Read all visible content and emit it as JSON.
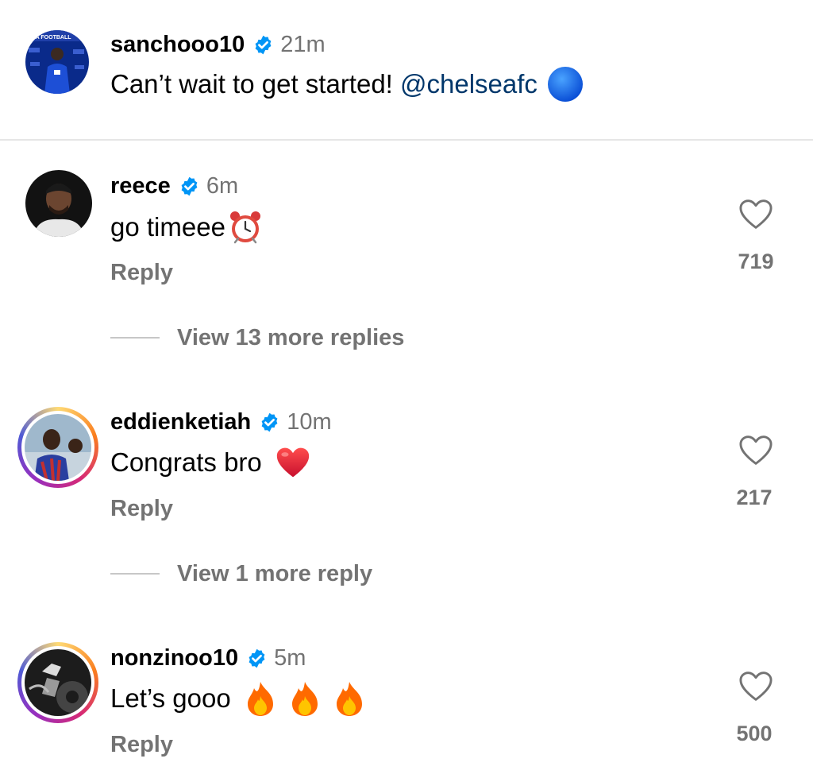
{
  "caption": {
    "username": "sanchooo10",
    "time": "21m",
    "text": "Can’t wait to get started! ",
    "mention": "@chelseafc",
    "emoji_icon": "blue-circle-icon",
    "avatar_icon": "player-avatar-icon"
  },
  "comments": [
    {
      "username": "reece",
      "time": "6m",
      "text": "go timeee",
      "emoji_icons": [
        "alarm-clock-icon"
      ],
      "reply_label": "Reply",
      "likes": "719",
      "view_replies": "View 13 more replies",
      "story_ring": false
    },
    {
      "username": "eddienketiah",
      "time": "10m",
      "text": "Congrats bro ",
      "emoji_icons": [
        "red-heart-icon"
      ],
      "reply_label": "Reply",
      "likes": "217",
      "view_replies": "View 1 more reply",
      "story_ring": true
    },
    {
      "username": "nonzinoo10",
      "time": "5m",
      "text": "Let’s gooo ",
      "emoji_icons": [
        "fire-icon",
        "fire-icon",
        "fire-icon"
      ],
      "reply_label": "Reply",
      "likes": "500",
      "story_ring": true
    }
  ],
  "colors": {
    "verified": "#0095f6",
    "mention": "#00376b",
    "secondary_text": "#737373"
  }
}
